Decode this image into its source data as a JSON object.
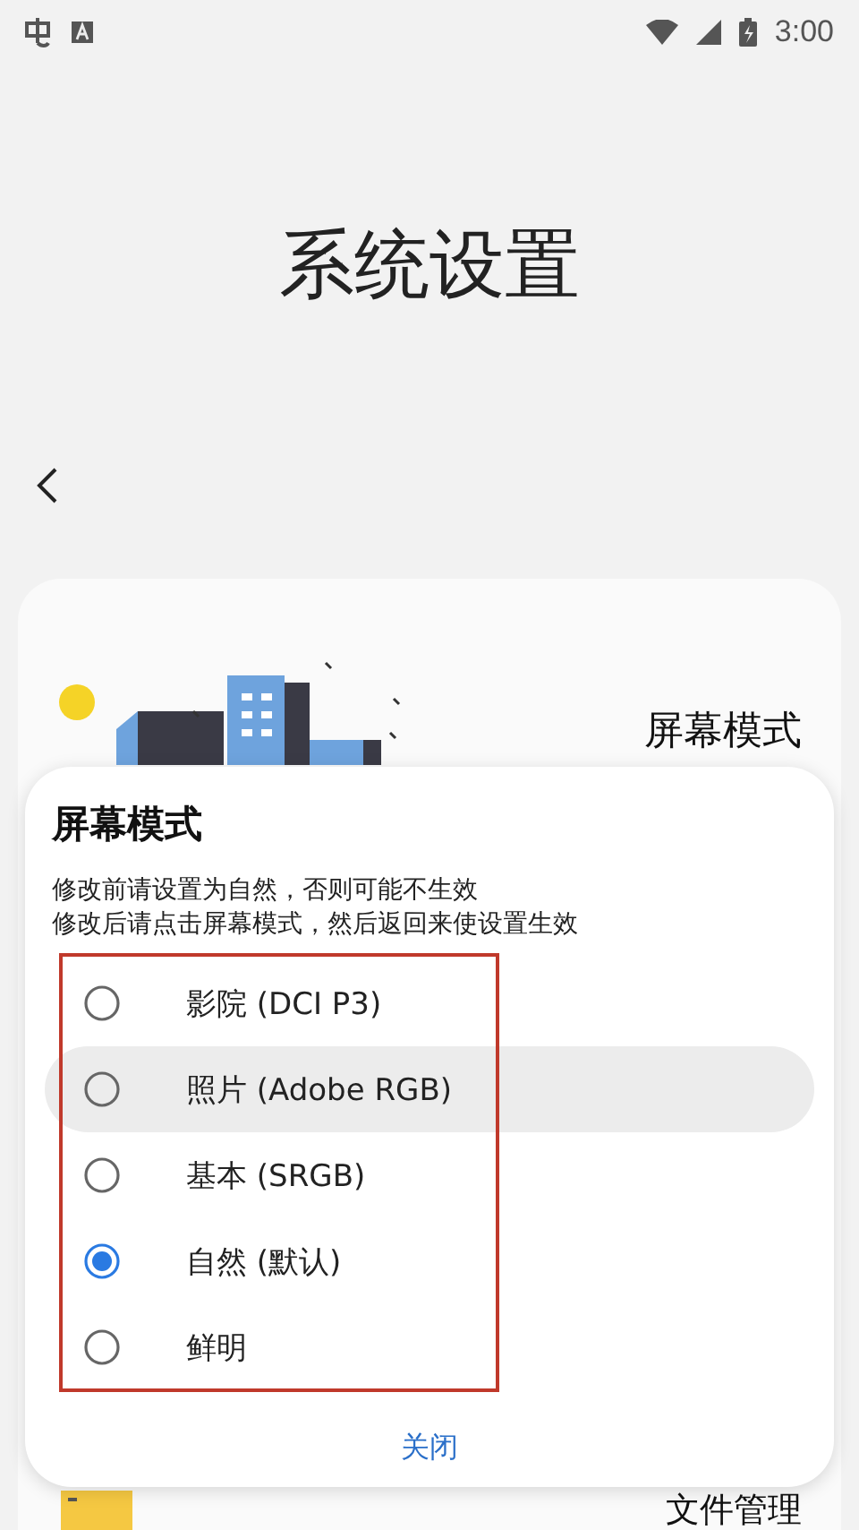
{
  "status_bar": {
    "time": "3:00"
  },
  "page": {
    "title": "系统设置"
  },
  "card": {
    "title": "屏幕模式",
    "next_item": "文件管理"
  },
  "dialog": {
    "title": "屏幕模式",
    "notes": [
      "修改前请设置为自然，否则可能不生效",
      "修改后请点击屏幕模式，然后返回来使设置生效"
    ],
    "options": [
      {
        "label": "影院 (DCI P3)",
        "selected": false,
        "pressed": false
      },
      {
        "label": "照片 (Adobe RGB)",
        "selected": false,
        "pressed": true
      },
      {
        "label": "基本 (SRGB)",
        "selected": false,
        "pressed": false
      },
      {
        "label": "自然 (默认)",
        "selected": true,
        "pressed": false
      },
      {
        "label": "鲜明",
        "selected": false,
        "pressed": false
      }
    ],
    "close_button": "关闭"
  }
}
